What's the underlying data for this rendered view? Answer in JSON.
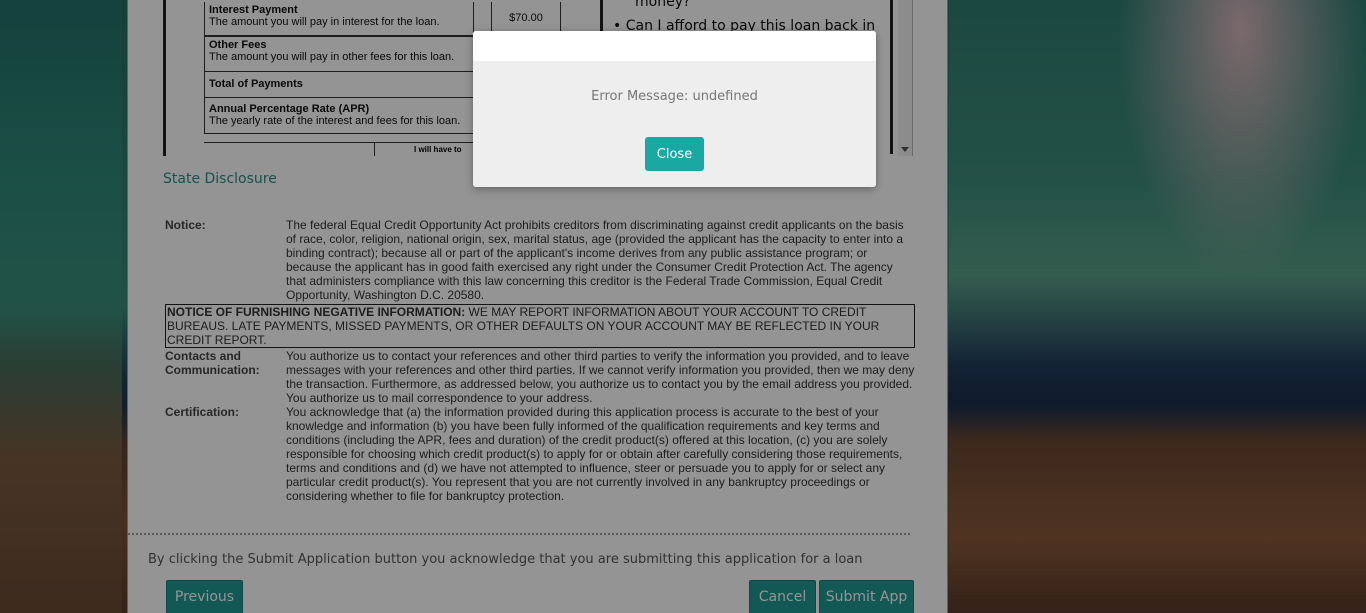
{
  "tila": {
    "interest_title": "Interest Payment",
    "interest_desc": "The amount you will pay in interest for the loan.",
    "interest_amount": "$70.00",
    "fees_title": "Other Fees",
    "fees_desc": "The amount you will pay in other fees for this loan.",
    "total_title": "Total of Payments",
    "apr_title": "Annual Percentage Rate (APR)",
    "apr_desc": "The yearly rate of the interest and fees for this loan.",
    "bottom_small": "I will have to"
  },
  "right_col": {
    "q1": "money?",
    "q2": "• Can I afford to pay this loan back in"
  },
  "state_disclosure": {
    "title": "State Disclosure",
    "notice_label": "Notice:",
    "notice_text": "The federal Equal Credit Opportunity Act prohibits creditors from discriminating against credit applicants on the basis of race, color, religion, national origin, sex, marital status, age (provided the applicant has the capacity to enter into a binding contract); because all or part of the applicant's income derives from any public assistance program; or because the applicant has in good faith exercised any right under the Consumer Credit Protection Act. The agency that administers compliance with this law concerning this creditor is the Federal Trade Commission, Equal Credit Opportunity, Washington D.C. 20580.",
    "negative_bold": "NOTICE OF FURNISHING NEGATIVE INFORMATION:",
    "negative_text": " WE MAY REPORT INFORMATION ABOUT YOUR ACCOUNT TO CREDIT BUREAUS. LATE PAYMENTS, MISSED PAYMENTS, OR OTHER DEFAULTS ON YOUR ACCOUNT MAY BE REFLECTED IN YOUR CREDIT REPORT.",
    "contacts_label": "Contacts and Communication:",
    "contacts_text": "You authorize us to contact your references and other third parties to verify the information you provided, and to leave messages with your references and other third parties. If we cannot verify information you provided, then we may deny the transaction. Furthermore, as addressed below, you authorize us to contact you by the email address you provided. You authorize us to mail correspondence to your address.",
    "cert_label": "Certification:",
    "cert_text": "You acknowledge that (a) the information provided during this application process is accurate to the best of your knowledge and information (b) you have been fully informed of the qualification requirements and key terms and conditions (including the APR, fees and duration) of the credit product(s) offered at this location, (c) you are solely responsible for choosing which credit product(s) to apply for or obtain after carefully considering those requirements, terms and conditions and (d) we have not attempted to influence, steer or persuade you to apply for or select any particular credit product(s). You represent that you are not currently involved in any bankruptcy proceedings or considering whether to file for bankruptcy protection."
  },
  "footer": {
    "ack": "By clicking the Submit Application button you acknowledge that you are submitting this application for a loan",
    "previous_label": "Previous",
    "cancel_label": "Cancel",
    "submit_label": "Submit App"
  },
  "modal": {
    "message": "Error Message: undefined",
    "close_label": "Close"
  },
  "colors": {
    "accent": "#1f9a95",
    "link_teal": "#2a8c86"
  }
}
